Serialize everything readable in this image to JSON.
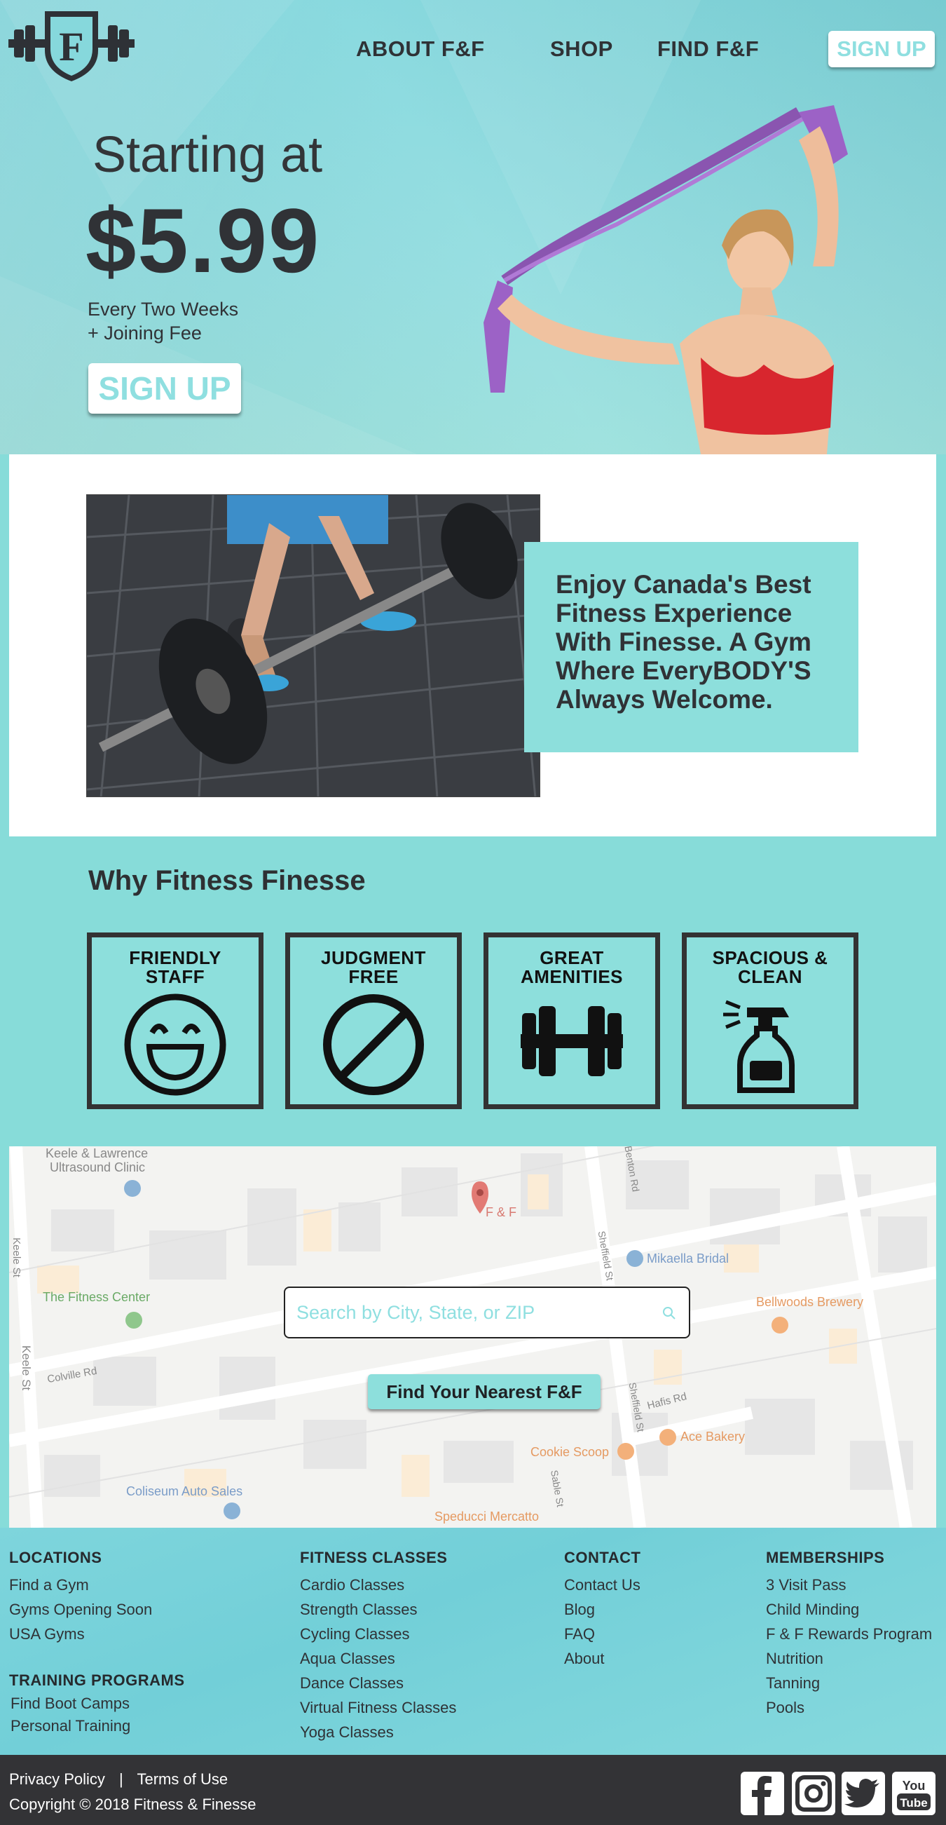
{
  "colors": {
    "accent": "#8ddfdc",
    "dark": "#333336",
    "white": "#ffffff"
  },
  "nav": {
    "about": "ABOUT F&F",
    "shop": "SHOP",
    "find": "FIND F&F",
    "signup": "SIGN UP"
  },
  "hero": {
    "starting": "Starting at",
    "price": "$5.99",
    "period": "Every Two Weeks",
    "fee": "+ Joining Fee",
    "signup": "SIGN UP"
  },
  "feature": {
    "text": "Enjoy Canada's Best Fitness Experience With Finesse. A Gym Where EveryBODY'S Always Welcome."
  },
  "why": {
    "title": "Why Fitness  Finesse",
    "tiles": [
      {
        "line1": "FRIENDLY",
        "line2": "STAFF",
        "icon": "smiley-icon"
      },
      {
        "line1": "JUDGMENT",
        "line2": "FREE",
        "icon": "no-sign-icon"
      },
      {
        "line1": "GREAT",
        "line2": "AMENITIES",
        "icon": "dumbbell-icon"
      },
      {
        "line1": "SPACIOUS &",
        "line2": "CLEAN",
        "icon": "spray-bottle-icon"
      }
    ]
  },
  "map": {
    "labels": {
      "clinic1": "Keele & Lawrence",
      "clinic2": "Ultrasound Clinic",
      "ff": "F & F",
      "bridal": "Mikaella Bridal",
      "fitness_center": "The Fitness Center",
      "brewery": "Bellwoods Brewery",
      "colville": "Colville Rd",
      "hafis": "Hafis Rd",
      "ace": "Ace Bakery",
      "cookie": "Cookie Scoop",
      "coliseum": "Coliseum Auto Sales",
      "speducci": "Speducci Mercatto",
      "keele1": "Keele St",
      "keele2": "Keele St",
      "sheffield1": "Sheffield St",
      "sheffield2": "Sheffield St",
      "sable": "Sable St",
      "benton": "Benton Rd"
    },
    "search_placeholder": "Search by City, State, or ZIP",
    "find_button": "Find Your Nearest F&F"
  },
  "footer": {
    "locations": {
      "title": "LOCATIONS",
      "links": [
        "Find a Gym",
        "Gyms Opening Soon",
        "USA Gyms"
      ]
    },
    "training": {
      "title": "TRAINING PROGRAMS",
      "links": [
        "Find Boot Camps",
        "Personal Training"
      ]
    },
    "classes": {
      "title": "FITNESS CLASSES",
      "links": [
        "Cardio Classes",
        "Strength Classes",
        "Cycling Classes",
        "Aqua Classes",
        "Dance Classes",
        "Virtual Fitness Classes",
        "Yoga Classes"
      ]
    },
    "contact": {
      "title": "CONTACT",
      "links": [
        "Contact Us",
        "Blog",
        "FAQ",
        "About"
      ]
    },
    "memberships": {
      "title": "MEMBERSHIPS",
      "links": [
        "3 Visit Pass",
        "Child Minding",
        "F & F Rewards Program",
        "Nutrition",
        "Tanning",
        "Pools"
      ]
    }
  },
  "legal": {
    "privacy": "Privacy Policy",
    "separator": "|",
    "terms": "Terms of Use",
    "copyright": "Copyright © 2018 Fitness & Finesse"
  },
  "social": [
    "facebook-icon",
    "instagram-icon",
    "twitter-icon",
    "youtube-icon"
  ]
}
